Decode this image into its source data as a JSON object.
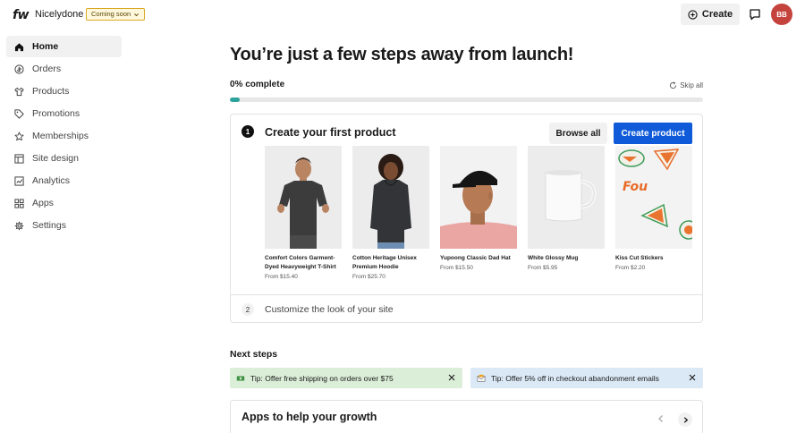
{
  "brand": {
    "logo": "fw",
    "store_name": "Nicelydone",
    "status_badge": "Coming soon"
  },
  "topbar": {
    "create_label": "Create",
    "avatar_initials": "BB",
    "avatar_color": "#c5433d"
  },
  "sidebar": {
    "items": [
      {
        "label": "Home",
        "icon": "home-icon",
        "active": true
      },
      {
        "label": "Orders",
        "icon": "orders-icon"
      },
      {
        "label": "Products",
        "icon": "shirt-icon"
      },
      {
        "label": "Promotions",
        "icon": "tag-icon"
      },
      {
        "label": "Memberships",
        "icon": "star-icon"
      },
      {
        "label": "Site design",
        "icon": "layout-icon"
      },
      {
        "label": "Analytics",
        "icon": "chart-icon"
      },
      {
        "label": "Apps",
        "icon": "grid-icon"
      },
      {
        "label": "Settings",
        "icon": "gear-icon"
      }
    ]
  },
  "main": {
    "headline": "You’re just a few steps away from launch!",
    "progress_label": "0% complete",
    "progress_value": 0.02,
    "skip_all_label": "Skip all",
    "step1": {
      "number": "1",
      "title": "Create your first product",
      "browse_label": "Browse all",
      "create_label": "Create product",
      "products": [
        {
          "name": "Comfort Colors Garment-Dyed Heavyweight T-Shirt",
          "price": "From $15.40"
        },
        {
          "name": "Cotton Heritage Unisex Premium Hoodie",
          "price": "From $25.70"
        },
        {
          "name": "Yupoong Classic Dad Hat",
          "price": "From $15.50"
        },
        {
          "name": "White Glossy Mug",
          "price": "From $5.95"
        },
        {
          "name": "Kiss Cut Stickers",
          "price": "From $2.20"
        }
      ]
    },
    "step2": {
      "number": "2",
      "title": "Customize the look of your site"
    },
    "next_steps_title": "Next steps",
    "tips": [
      {
        "text": "Tip: Offer free shipping on orders over $75",
        "color": "#dbeed8"
      },
      {
        "text": "Tip: Offer 5% off in checkout abandonment emails",
        "color": "#dbe9f6"
      }
    ],
    "apps_title": "Apps to help your growth"
  },
  "colors": {
    "accent_blue": "#0f5ad8",
    "progress_teal": "#2ea39b"
  }
}
